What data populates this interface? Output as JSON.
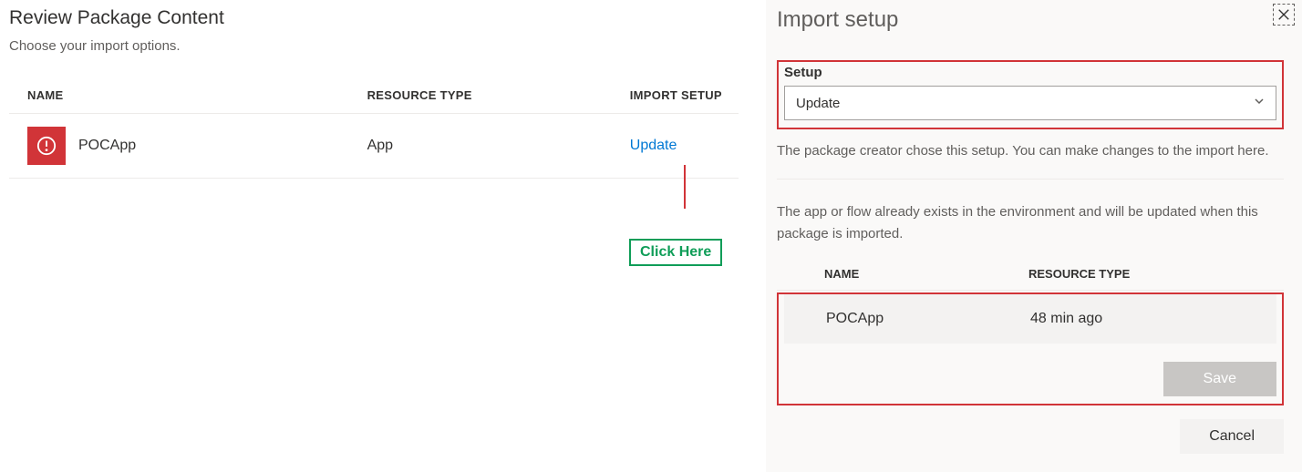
{
  "left": {
    "title": "Review Package Content",
    "subtitle": "Choose your import options.",
    "headers": {
      "name": "NAME",
      "type": "RESOURCE TYPE",
      "setup": "IMPORT SETUP"
    },
    "row": {
      "name": "POCApp",
      "type": "App",
      "setup": "Update"
    },
    "annotation": "Click Here"
  },
  "right": {
    "title": "Import setup",
    "setup": {
      "label": "Setup",
      "value": "Update"
    },
    "helper1": "The package creator chose this setup. You can make changes to the import here.",
    "helper2": "The app or flow already exists in the environment and will be updated when this package is imported.",
    "headers": {
      "name": "NAME",
      "type": "RESOURCE TYPE"
    },
    "row": {
      "name": "POCApp",
      "type": "48 min ago"
    },
    "buttons": {
      "save": "Save",
      "cancel": "Cancel"
    }
  }
}
